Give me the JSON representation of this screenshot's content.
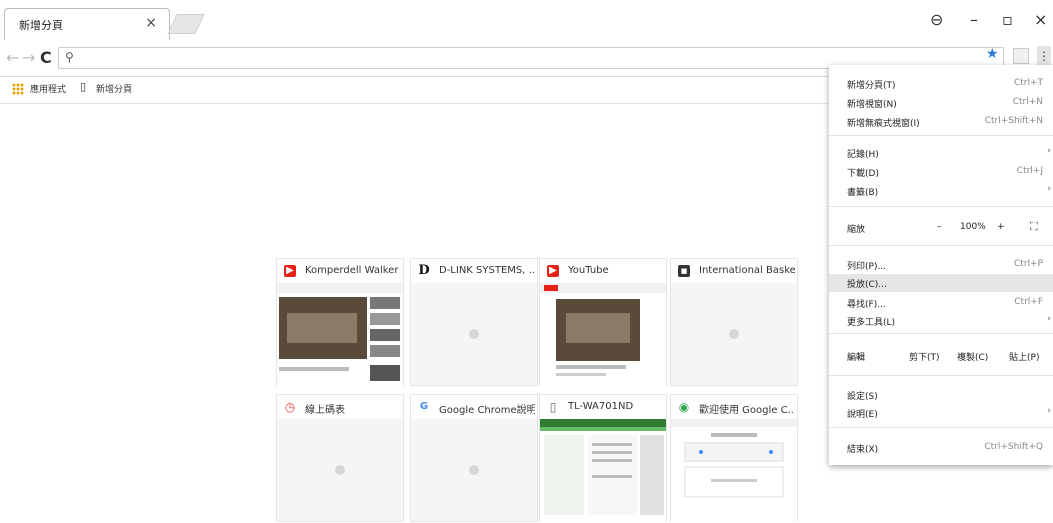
{
  "tab": {
    "title": "新增分頁",
    "close": "×"
  },
  "window": {
    "profile": "⊖",
    "minimize": "–",
    "restore": "▫",
    "close": "×"
  },
  "toolbar": {
    "back": "←",
    "forward": "→",
    "reload": "C",
    "search_icon": "⚲",
    "url": "",
    "star": "★",
    "menu": "⋮"
  },
  "bookmarks": {
    "apps": "應用程式",
    "newtab": "新增分頁"
  },
  "tiles": [
    {
      "title": "Komperdell Walker ...",
      "icon": "▶",
      "icon_color": "#e62117"
    },
    {
      "title": "D-LINK SYSTEMS, ...",
      "icon": "D",
      "icon_color": "#111111"
    },
    {
      "title": "YouTube",
      "icon": "▶",
      "icon_color": "#e62117"
    },
    {
      "title": "International Basket...",
      "icon": "■",
      "icon_color": "#333333"
    },
    {
      "title": "線上碼表",
      "icon": "◷",
      "icon_color": "#e53935"
    },
    {
      "title": "Google Chrome說明",
      "icon": "G",
      "icon_color": "#4285f4"
    },
    {
      "title": "TL-WA701ND",
      "icon": "▯",
      "icon_color": "#666666"
    },
    {
      "title": "歡迎使用 Google C...",
      "icon": "◉",
      "icon_color": "#34a853"
    }
  ],
  "menu": {
    "new_tab": "新增分頁(T)",
    "new_tab_sc": "Ctrl+T",
    "new_window": "新增視窗(N)",
    "new_window_sc": "Ctrl+N",
    "incognito": "新增無痕式視窗(I)",
    "incognito_sc": "Ctrl+Shift+N",
    "history": "記錄(H)",
    "downloads": "下載(D)",
    "downloads_sc": "Ctrl+J",
    "bookmarks": "書籤(B)",
    "zoom": "縮放",
    "zoom_minus": "–",
    "zoom_value": "100%",
    "zoom_plus": "+",
    "fullscreen": "⛶",
    "print": "列印(P)...",
    "print_sc": "Ctrl+P",
    "cast": "投放(C)...",
    "find": "尋找(F)...",
    "find_sc": "Ctrl+F",
    "more_tools": "更多工具(L)",
    "edit": "編輯",
    "cut": "剪下(T)",
    "copy": "複製(C)",
    "paste": "貼上(P)",
    "settings": "設定(S)",
    "help": "說明(E)",
    "exit": "結束(X)",
    "exit_sc": "Ctrl+Shift+Q"
  }
}
